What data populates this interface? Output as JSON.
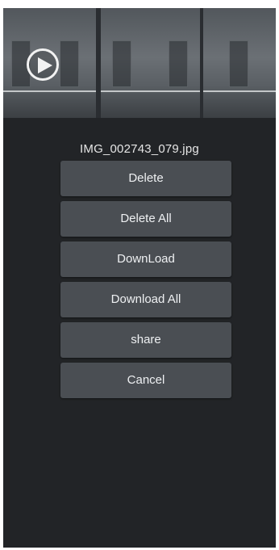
{
  "video": {
    "play_icon": "play-circle-icon"
  },
  "dialog": {
    "filename": "IMG_002743_079.jpg",
    "options": [
      {
        "name": "delete-button",
        "label": "Delete"
      },
      {
        "name": "delete-all-button",
        "label": "Delete All"
      },
      {
        "name": "download-button",
        "label": "DownLoad"
      },
      {
        "name": "download-all-button",
        "label": "Download All"
      },
      {
        "name": "share-button",
        "label": "share"
      },
      {
        "name": "cancel-button",
        "label": "Cancel"
      }
    ]
  },
  "colors": {
    "background": "#222427",
    "button": "#4a4e53",
    "text": "#eef0f2"
  }
}
